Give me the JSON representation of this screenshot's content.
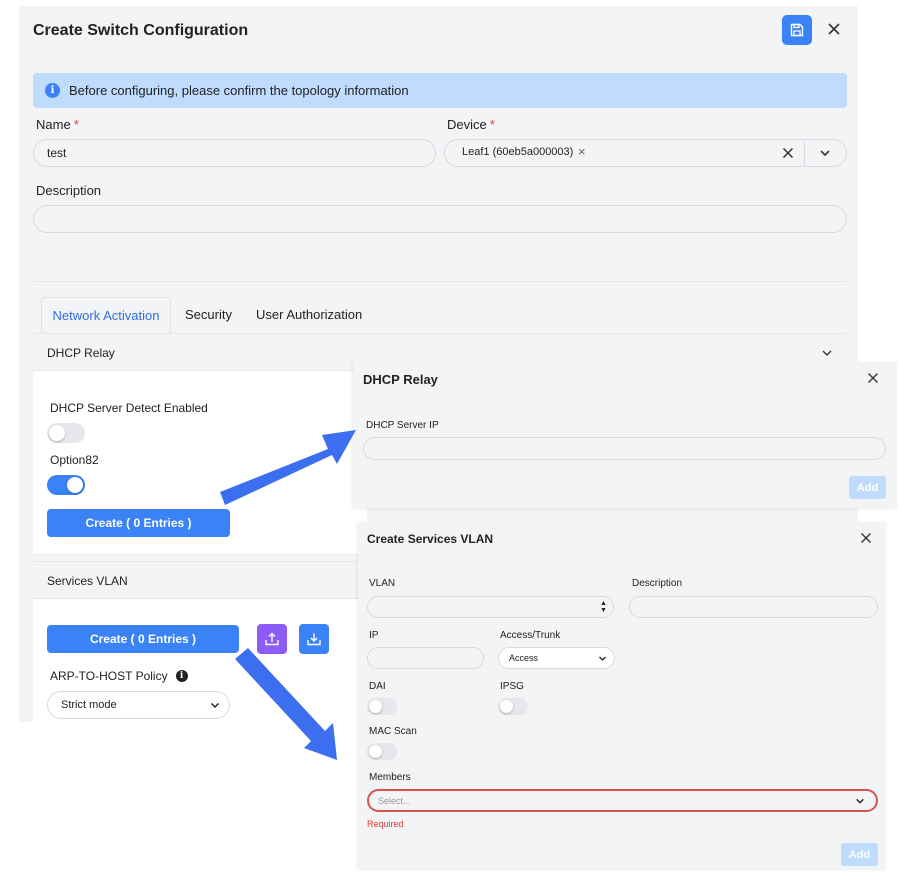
{
  "main": {
    "title": "Create Switch Configuration",
    "info_text": "Before configuring, please confirm the topology information",
    "name_label": "Name",
    "name_value": "test",
    "device_label": "Device",
    "device_tag": "Leaf1 (60eb5a000003)",
    "description_label": "Description",
    "description_value": "",
    "required_mark": "*",
    "tabs": [
      {
        "label": "Network Activation",
        "active": true
      },
      {
        "label": "Security",
        "active": false
      },
      {
        "label": "User Authorization",
        "active": false
      }
    ],
    "dhcp_relay": {
      "title": "DHCP Relay",
      "server_detect_label": "DHCP Server Detect Enabled",
      "server_detect_on": false,
      "option82_label": "Option82",
      "option82_on": true,
      "create_label": "Create ( 0 Entries )"
    },
    "services_vlan": {
      "title": "Services VLAN",
      "create_label": "Create ( 0 Entries )",
      "arp_label": "ARP-TO-HOST Policy",
      "arp_value": "Strict mode"
    }
  },
  "relay_dialog": {
    "title": "DHCP Relay",
    "server_ip_label": "DHCP Server IP",
    "server_ip_value": "",
    "add_label": "Add"
  },
  "vlan_dialog": {
    "title": "Create Services VLAN",
    "vlan_label": "VLAN",
    "description_label": "Description",
    "ip_label": "IP",
    "access_trunk_label": "Access/Trunk",
    "access_trunk_value": "Access",
    "dai_label": "DAI",
    "ipsg_label": "IPSG",
    "mac_scan_label": "MAC Scan",
    "members_label": "Members",
    "members_placeholder": "Select...",
    "required_text": "Required",
    "add_label": "Add"
  },
  "colors": {
    "primary": "#3b82f6",
    "info_bg": "#bfdbfe",
    "purple": "#8b5cf6",
    "error": "#e53935",
    "arrow": "#3b6ff0"
  }
}
